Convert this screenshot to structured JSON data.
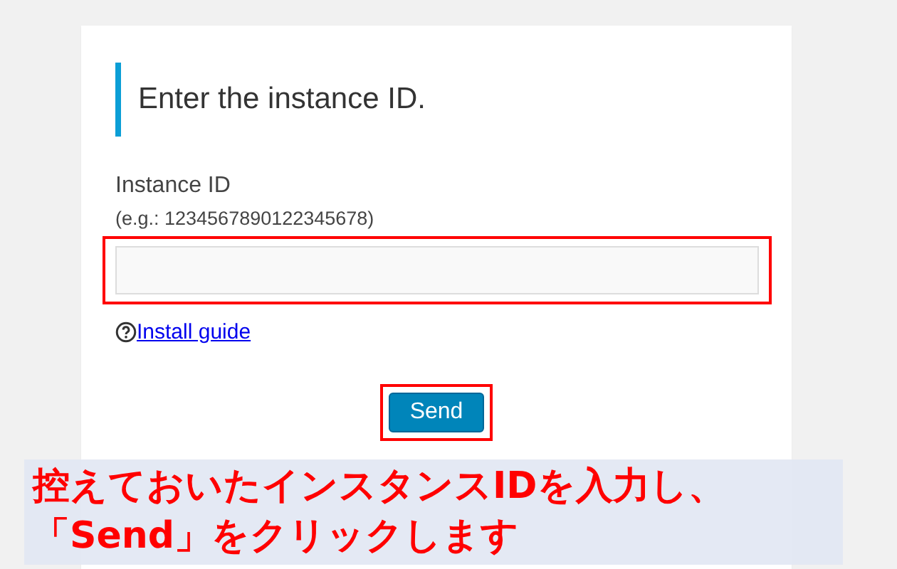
{
  "card": {
    "heading": "Enter the instance ID.",
    "field_label": "Instance ID",
    "field_hint": "(e.g.: 1234567890122345678)",
    "help_link": "Install guide",
    "button": "Send"
  },
  "annotation": {
    "caption_lines": [
      "控えておいたインスタンスIDを入力し、",
      "「Send」をクリックします"
    ],
    "highlight_field": true,
    "highlight_button": true
  }
}
